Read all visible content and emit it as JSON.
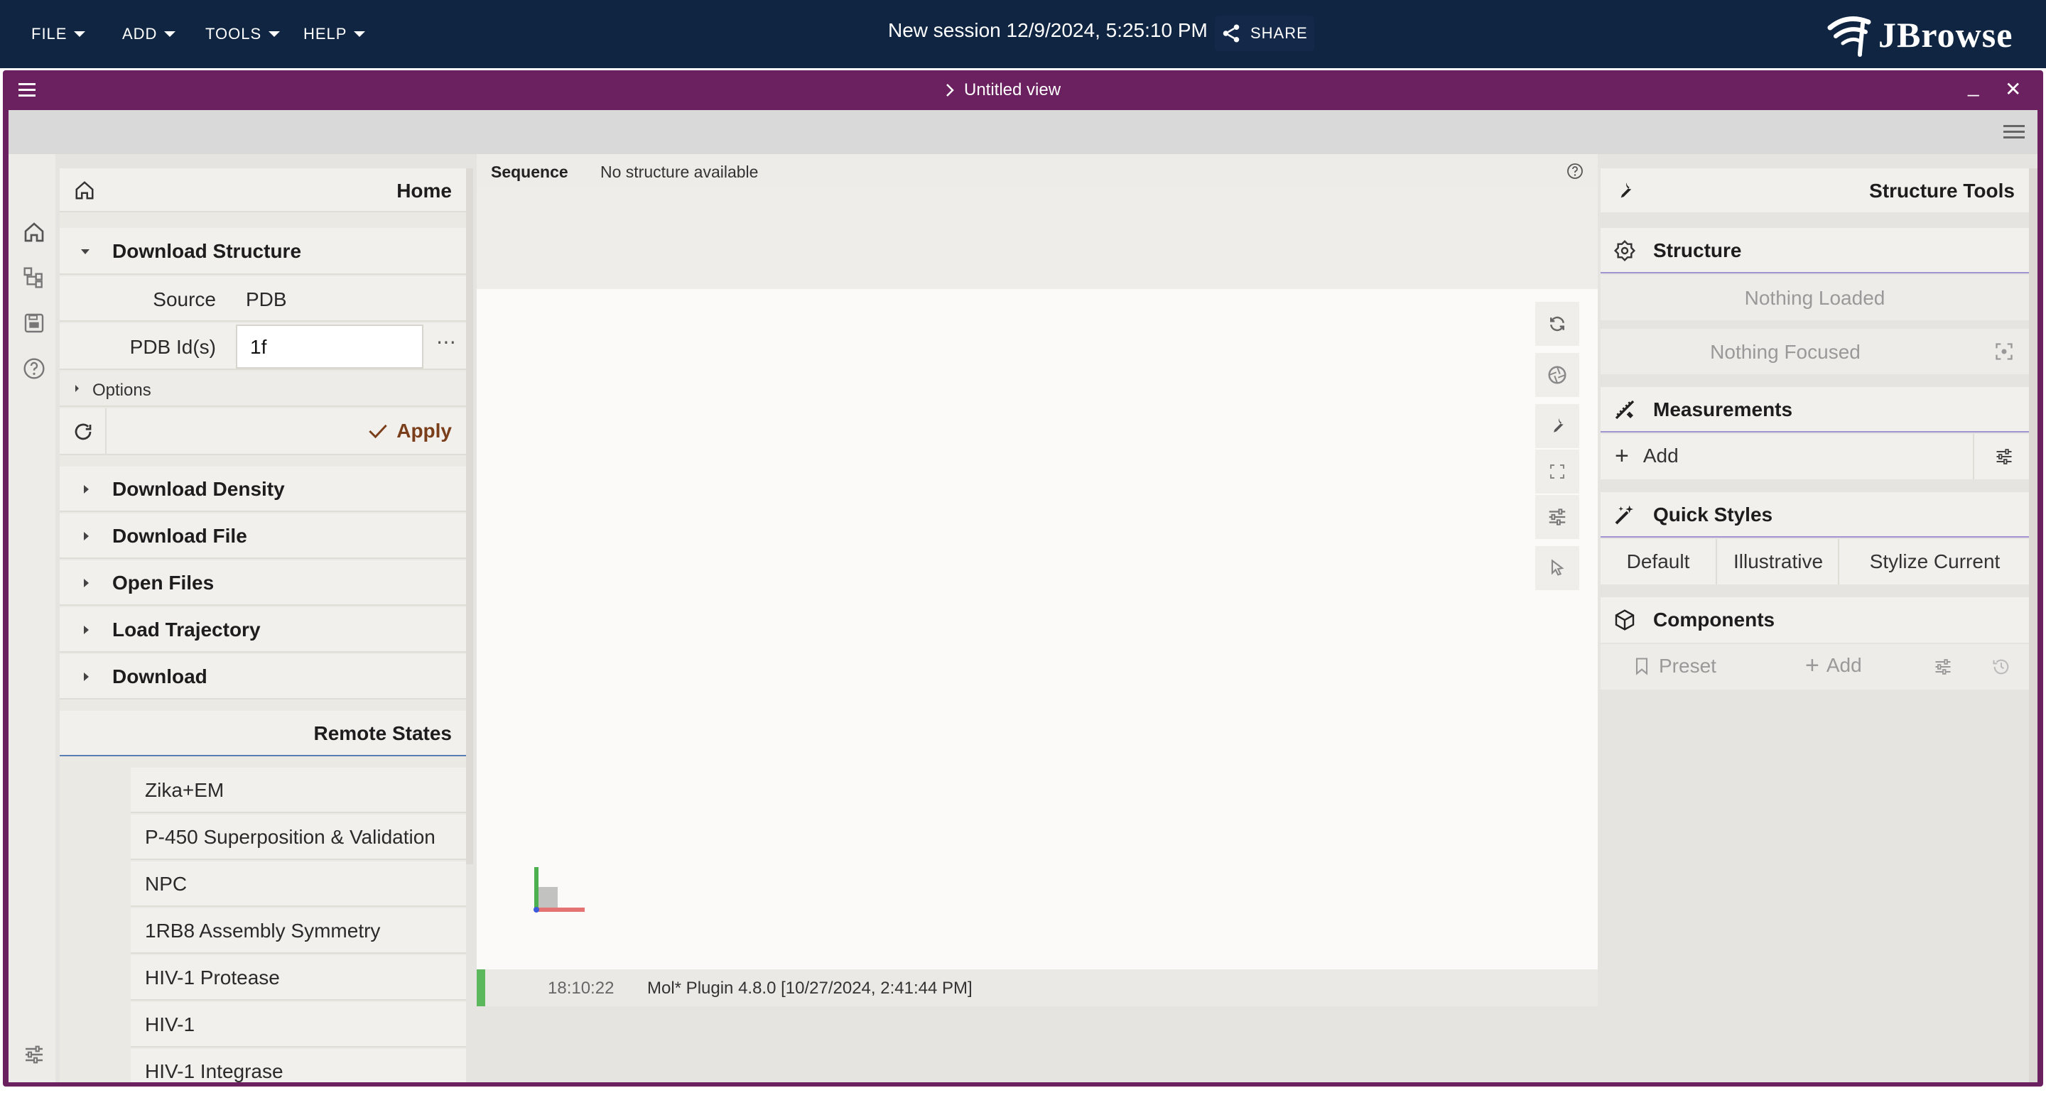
{
  "topbar": {
    "menus": [
      "FILE",
      "ADD",
      "TOOLS",
      "HELP"
    ],
    "session_title": "New session 12/9/2024, 5:25:10 PM",
    "share_label": "SHARE",
    "logo_text": "JBrowse"
  },
  "view": {
    "title": "Untitled view",
    "minimize": "_",
    "close": "✕"
  },
  "left_panel": {
    "home_label": "Home",
    "download_structure": {
      "title": "Download Structure",
      "source_label": "Source",
      "source_value": "PDB",
      "pdb_label": "PDB Id(s)",
      "pdb_value": "1f",
      "more": "⋯",
      "options_label": "Options",
      "apply_label": "Apply"
    },
    "collapsed_sections": [
      "Download Density",
      "Download File",
      "Open Files",
      "Load Trajectory",
      "Download"
    ],
    "remote_states_title": "Remote States",
    "remote_states": [
      "Zika+EM",
      "P-450 Superposition & Validation",
      "NPC",
      "1RB8 Assembly Symmetry",
      "HIV-1 Protease",
      "HIV-1",
      "HIV-1 Integrase"
    ]
  },
  "center": {
    "sequence_label": "Sequence",
    "sequence_status": "No structure available",
    "log": {
      "time": "18:10:22",
      "message": "Mol* Plugin 4.8.0 [10/27/2024, 2:41:44 PM]"
    }
  },
  "right_panel": {
    "title": "Structure Tools",
    "structure": {
      "title": "Structure",
      "loaded": "Nothing Loaded",
      "focused": "Nothing Focused"
    },
    "measurements": {
      "title": "Measurements",
      "add_label": "Add"
    },
    "quick_styles": {
      "title": "Quick Styles",
      "buttons": [
        "Default",
        "Illustrative",
        "Stylize Current"
      ]
    },
    "components": {
      "title": "Components",
      "preset_label": "Preset",
      "add_label": "Add"
    }
  },
  "colors": {
    "topbar": "#0f2541",
    "view_frame": "#6b2060",
    "accent_brown": "#7a3e1a",
    "section_underline": "#a393d1"
  }
}
